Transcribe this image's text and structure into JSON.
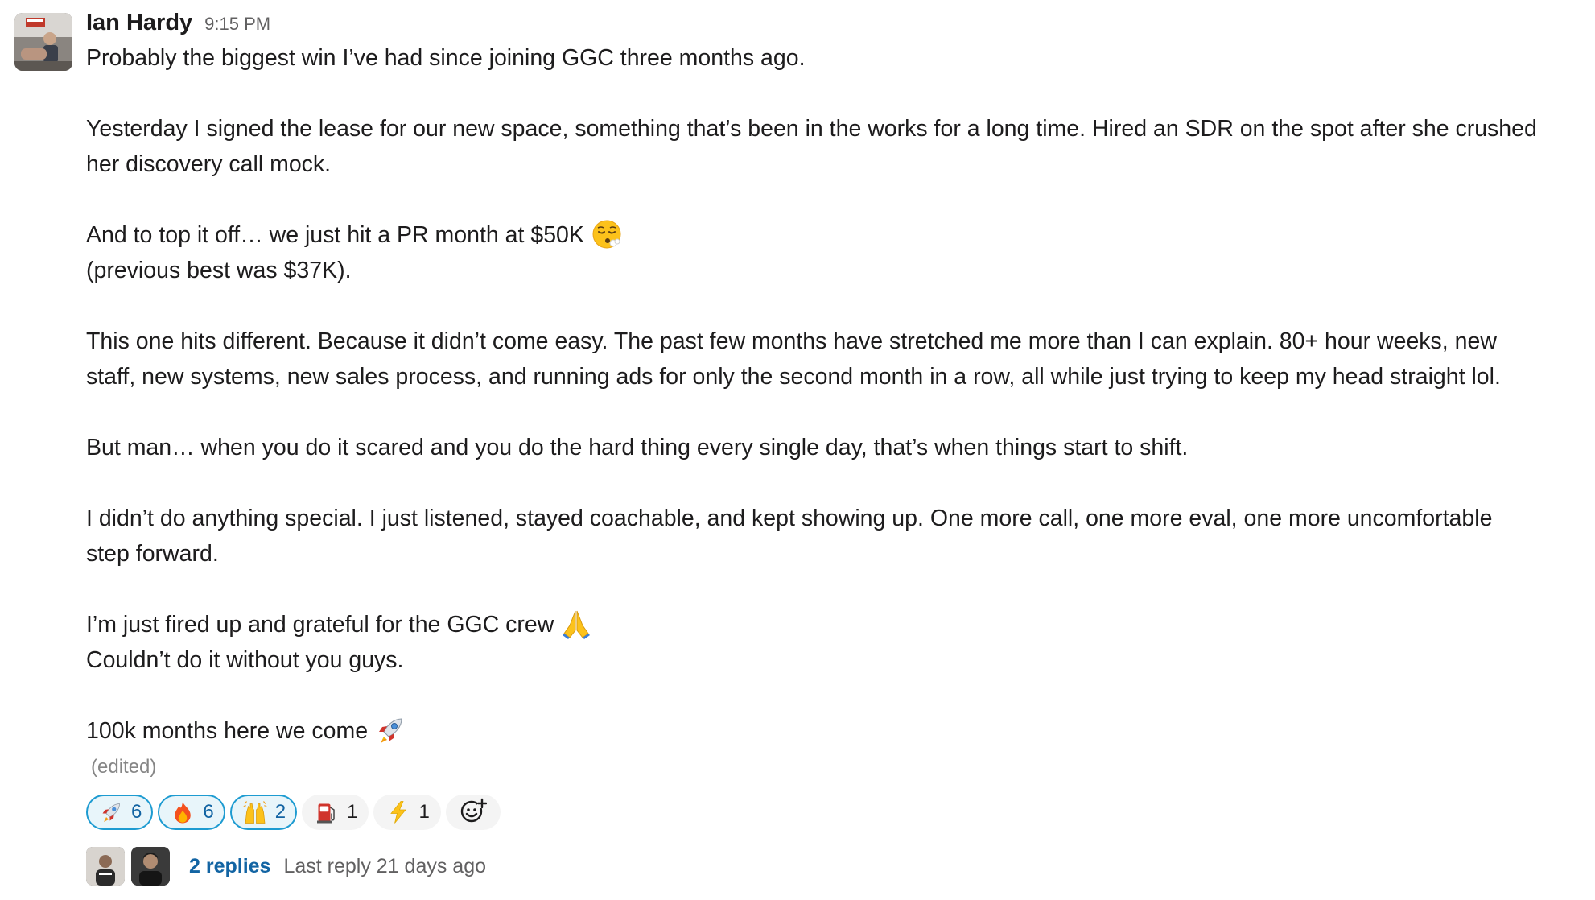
{
  "message": {
    "author": "Ian Hardy",
    "time": "9:15 PM",
    "avatar_icon": "user-avatar-photo",
    "paragraphs": [
      {
        "lines": [
          "Probably the biggest win I’ve had since joining GGC three months ago."
        ]
      },
      {
        "lines": [
          "Yesterday I signed the lease for our new space, something that’s been in the works for a long time. Hired an SDR on the spot after she crushed",
          "her discovery call mock."
        ]
      },
      {
        "lines": [
          "And to top it off… we just hit a PR month at $50K",
          "(previous best was $37K)."
        ]
      },
      {
        "lines": [
          "This one hits different. Because it didn’t come easy. The past few months have stretched me more than I can explain. 80+ hour weeks, new",
          "staff, new systems, new sales process, and running ads for only the second month in a row, all while just trying to keep my head straight lol."
        ]
      },
      {
        "lines": [
          "But man… when you do it scared and you do the hard thing every single day, that’s when things start to shift."
        ]
      },
      {
        "lines": [
          "I didn’t do anything special. I just listened, stayed coachable, and kept showing up. One more call, one more eval, one more uncomfortable",
          "step forward."
        ]
      },
      {
        "lines": [
          "I’m just fired up and grateful for the GGC crew",
          "Couldn’t do it without you guys."
        ]
      },
      {
        "lines": [
          "100k months here we come"
        ]
      }
    ],
    "inline_emojis": [
      "face-exhaling-emoji",
      "folded-hands-emoji",
      "rocket-emoji"
    ],
    "edited_label": "(edited)"
  },
  "reactions": [
    {
      "emoji": "rocket",
      "count": "6",
      "active": true
    },
    {
      "emoji": "fire",
      "count": "6",
      "active": true
    },
    {
      "emoji": "raised-hands",
      "count": "2",
      "active": true
    },
    {
      "emoji": "fuel-pump",
      "count": "1",
      "active": false
    },
    {
      "emoji": "high-voltage",
      "count": "1",
      "active": false
    }
  ],
  "add_reaction_icon": "add-reaction-icon",
  "thread": {
    "replies_label": "2 replies",
    "last_reply_label": "Last reply 21 days ago"
  },
  "colors": {
    "link_blue": "#1264a3",
    "reaction_active_border": "#1d9bd1",
    "reaction_active_bg": "#e8f5fa",
    "reaction_bg": "#f4f4f4"
  }
}
